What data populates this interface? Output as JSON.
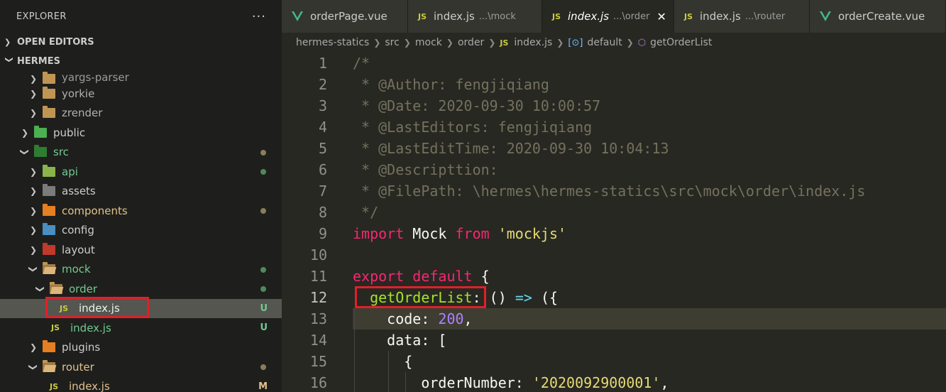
{
  "sidebar": {
    "title": "EXPLORER",
    "more": "···",
    "open_editors": "OPEN EDITORS",
    "project": "HERMES",
    "tree": {
      "yargs": "yargs-parser",
      "yorkie": "yorkie",
      "zrender": "zrender",
      "public": "public",
      "src": "src",
      "api": "api",
      "assets": "assets",
      "components": "components",
      "config": "config",
      "layout": "layout",
      "mock": "mock",
      "order": "order",
      "order_index": "index.js",
      "order_index_badge": "U",
      "mock_index": "index.js",
      "mock_index_badge": "U",
      "plugins": "plugins",
      "router": "router",
      "router_index": "index.js",
      "router_index_badge": "M"
    },
    "js_tag": "JS"
  },
  "tabs": [
    {
      "name": "orderPage.vue",
      "desc": ""
    },
    {
      "name": "index.js",
      "desc": "...\\mock"
    },
    {
      "name": "index.js",
      "desc": "...\\order"
    },
    {
      "name": "index.js",
      "desc": "...\\router"
    },
    {
      "name": "orderCreate.vue",
      "desc": ""
    }
  ],
  "breadcrumb": {
    "p1": "hermes-statics",
    "p2": "src",
    "p3": "mock",
    "p4": "order",
    "p5": "index.js",
    "p6": "default",
    "p7": "getOrderList"
  },
  "editor": {
    "line_numbers": [
      "1",
      "2",
      "3",
      "4",
      "5",
      "6",
      "7",
      "8",
      "9",
      "10",
      "11",
      "12",
      "13",
      "14",
      "15",
      "16"
    ],
    "l1": "/*",
    "l2_ws": " * ",
    "l2_text": "@Author: fengjiqiang",
    "l3_ws": " * ",
    "l3_text": "@Date: 2020-09-30 10:00:57",
    "l4_ws": " * ",
    "l4_text": "@LastEditors: fengjiqiang",
    "l5_ws": " * ",
    "l5_text": "@LastEditTime: 2020-09-30 10:04:13",
    "l6_ws": " * ",
    "l6_text": "@Descripttion:",
    "l7_ws": " * ",
    "l7_text": "@FilePath: \\hermes\\hermes-statics\\src\\mock\\order\\index.js",
    "l8": " */",
    "l9_import": "import",
    "l9_mock": " Mock ",
    "l9_from": "from",
    "l9_str": "'mockjs'",
    "l11_export": "export",
    "l11_default": "default",
    "l11_brace": " {",
    "l12_fn": "getOrderList",
    "l12_colon": ":",
    "l12_paren": " () ",
    "l12_arrow": "=>",
    "l12_end": " ({",
    "l13_key": "code: ",
    "l13_num": "200",
    "l13_end": ",",
    "l14_key": "data: [",
    "l15_brace": "{",
    "l16_key": "orderNumber: ",
    "l16_str": "'2020092900001'",
    "l16_end": ","
  }
}
